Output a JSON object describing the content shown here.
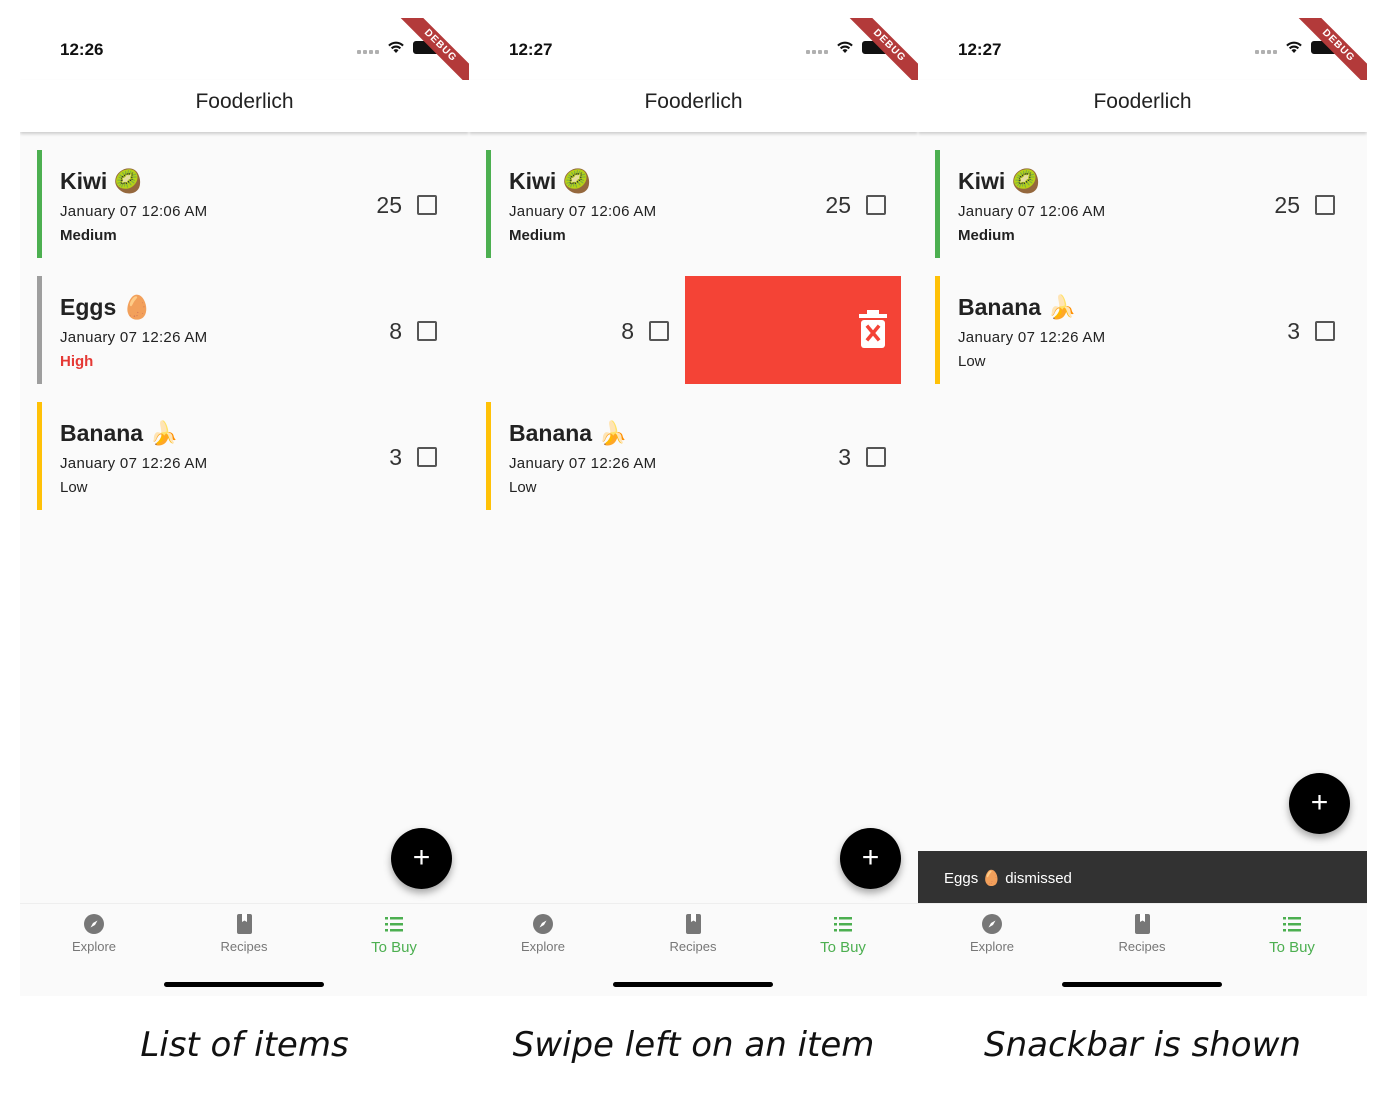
{
  "screens": [
    {
      "time": "12:26",
      "app_title": "Fooderlich",
      "debug_label": "DEBUG",
      "items": [
        {
          "name": "Kiwi 🥝",
          "date": "January 07 12:06 AM",
          "importance": "Medium",
          "quantity": "25",
          "color": "#4caf50"
        },
        {
          "name": "Eggs 🥚",
          "date": "January 07 12:26 AM",
          "importance": "High",
          "quantity": "8",
          "color": "#9e9e9e"
        },
        {
          "name": "Banana 🍌",
          "date": "January 07 12:26 AM",
          "importance": "Low",
          "quantity": "3",
          "color": "#ffc107"
        }
      ],
      "fab_label": "+",
      "nav": [
        {
          "label": "Explore",
          "icon": "compass-icon"
        },
        {
          "label": "Recipes",
          "icon": "book-icon"
        },
        {
          "label": "To Buy",
          "icon": "list-icon",
          "active": true
        }
      ],
      "caption": "List of items"
    },
    {
      "time": "12:27",
      "app_title": "Fooderlich",
      "debug_label": "DEBUG",
      "items": [
        {
          "name": "Kiwi 🥝",
          "date": "January 07 12:06 AM",
          "importance": "Medium",
          "quantity": "25",
          "color": "#4caf50"
        },
        {
          "name": "",
          "date": "",
          "importance": "",
          "quantity": "8",
          "color": "#9e9e9e"
        },
        {
          "name": "Banana 🍌",
          "date": "January 07 12:26 AM",
          "importance": "Low",
          "quantity": "3",
          "color": "#ffc107"
        }
      ],
      "swipe_icon": "delete-forever-icon",
      "fab_label": "+",
      "nav": [
        {
          "label": "Explore",
          "icon": "compass-icon"
        },
        {
          "label": "Recipes",
          "icon": "book-icon"
        },
        {
          "label": "To Buy",
          "icon": "list-icon",
          "active": true
        }
      ],
      "caption": "Swipe left on an item"
    },
    {
      "time": "12:27",
      "app_title": "Fooderlich",
      "debug_label": "DEBUG",
      "items": [
        {
          "name": "Kiwi 🥝",
          "date": "January 07 12:06 AM",
          "importance": "Medium",
          "quantity": "25",
          "color": "#4caf50"
        },
        {
          "name": "Banana 🍌",
          "date": "January 07 12:26 AM",
          "importance": "Low",
          "quantity": "3",
          "color": "#ffc107"
        }
      ],
      "snackbar": "Eggs 🥚 dismissed",
      "fab_label": "+",
      "nav": [
        {
          "label": "Explore",
          "icon": "compass-icon"
        },
        {
          "label": "Recipes",
          "icon": "book-icon"
        },
        {
          "label": "To Buy",
          "icon": "list-icon",
          "active": true
        }
      ],
      "caption": "Snackbar is shown"
    }
  ],
  "colors": {
    "accent": "#4caf50",
    "delete": "#f44336",
    "high": "#e53935",
    "snackbar": "#323232"
  }
}
